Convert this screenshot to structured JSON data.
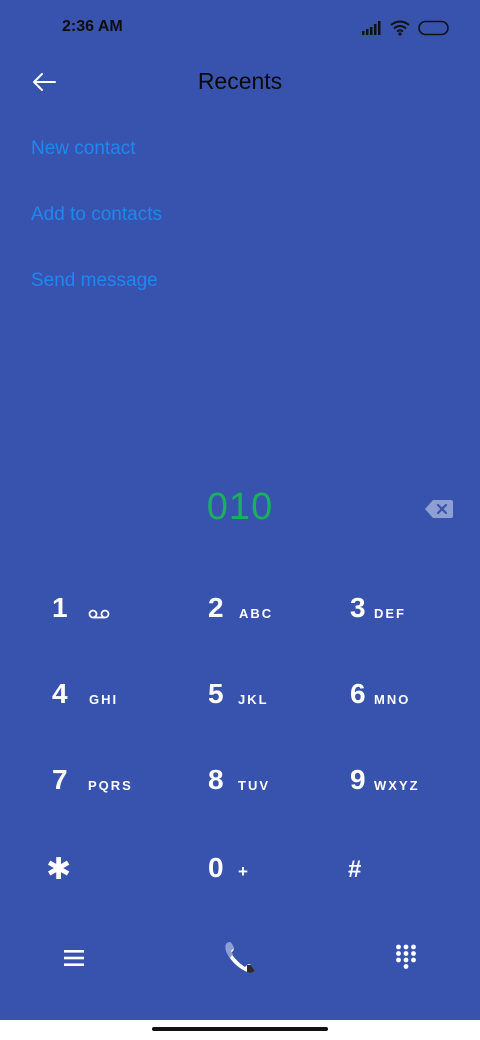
{
  "status_bar": {
    "time": "2:36 AM",
    "icons": [
      "signal-icon",
      "wifi-icon",
      "battery-icon"
    ]
  },
  "header": {
    "title": "Recents",
    "back_icon": "back-arrow-icon"
  },
  "options": [
    {
      "label": "New contact"
    },
    {
      "label": "Add to contacts"
    },
    {
      "label": "Send message"
    }
  ],
  "dialer": {
    "number": "010",
    "backspace_icon": "backspace-icon"
  },
  "keypad": {
    "keys": [
      {
        "digit": "1",
        "letters": "",
        "extra_icon": "voicemail-icon"
      },
      {
        "digit": "2",
        "letters": "ABC"
      },
      {
        "digit": "3",
        "letters": "DEF"
      },
      {
        "digit": "4",
        "letters": "GHI"
      },
      {
        "digit": "5",
        "letters": "JKL"
      },
      {
        "digit": "6",
        "letters": "MNO"
      },
      {
        "digit": "7",
        "letters": "PQRS"
      },
      {
        "digit": "8",
        "letters": "TUV"
      },
      {
        "digit": "9",
        "letters": "WXYZ"
      },
      {
        "digit": "✱",
        "letters": ""
      },
      {
        "digit": "0",
        "letters": "+"
      },
      {
        "digit": "#",
        "letters": ""
      }
    ]
  },
  "bottom_bar": {
    "menu_icon": "menu-icon",
    "call_icon": "phone-icon",
    "keypad_icon": "dialpad-icon"
  },
  "colors": {
    "background": "#3853AE",
    "link": "#1e88f0",
    "number": "#19b15e",
    "text_dark": "#0a0a0a"
  }
}
